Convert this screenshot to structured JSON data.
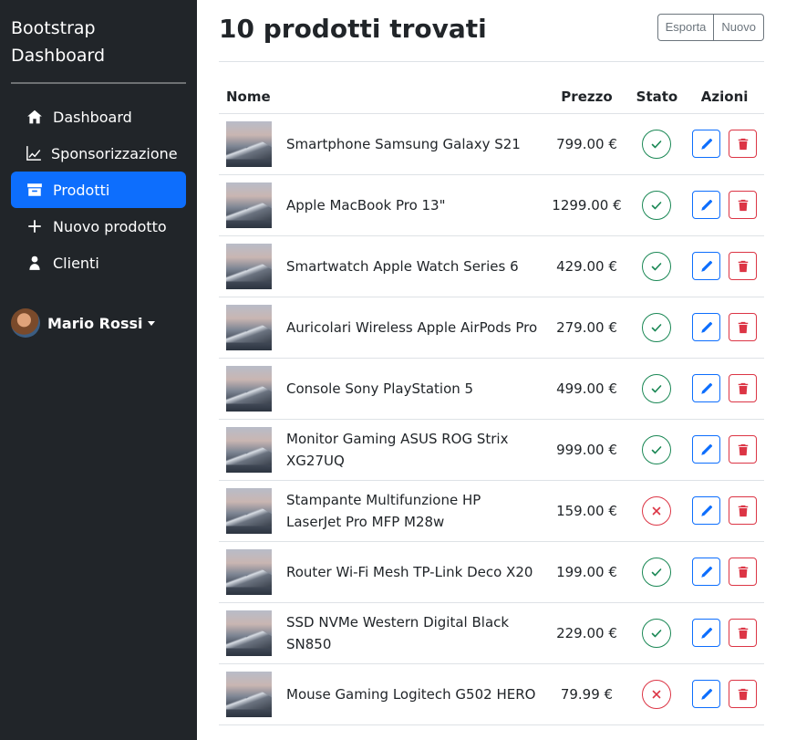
{
  "sidebar": {
    "brand_line1": "Bootstrap",
    "brand_line2": "Dashboard",
    "items": [
      {
        "label": "Dashboard",
        "icon": "home-icon"
      },
      {
        "label": "Sponsorizzazione",
        "icon": "chart-line-icon"
      },
      {
        "label": "Prodotti",
        "icon": "archive-box-icon",
        "active": true
      },
      {
        "label": "Nuovo prodotto",
        "icon": "plus-icon"
      },
      {
        "label": "Clienti",
        "icon": "user-icon"
      }
    ],
    "user_name": "Mario Rossi"
  },
  "header": {
    "title": "10 prodotti trovati",
    "export_label": "Esporta",
    "new_label": "Nuovo"
  },
  "table": {
    "columns": [
      "Nome",
      "Prezzo",
      "Stato",
      "Azioni"
    ],
    "rows": [
      {
        "name": "Smartphone Samsung Galaxy S21",
        "price": "799.00 €",
        "status": "ok"
      },
      {
        "name": "Apple MacBook Pro 13\"",
        "price": "1299.00 €",
        "status": "ok"
      },
      {
        "name": "Smartwatch Apple Watch Series 6",
        "price": "429.00 €",
        "status": "ok"
      },
      {
        "name": "Auricolari Wireless Apple AirPods Pro",
        "price": "279.00 €",
        "status": "ok"
      },
      {
        "name": "Console Sony PlayStation 5",
        "price": "499.00 €",
        "status": "ok"
      },
      {
        "name": "Monitor Gaming ASUS ROG Strix XG27UQ",
        "price": "999.00 €",
        "status": "ok"
      },
      {
        "name": "Stampante Multifunzione HP LaserJet Pro MFP M28w",
        "price": "159.00 €",
        "status": "no"
      },
      {
        "name": "Router Wi-Fi Mesh TP-Link Deco X20",
        "price": "199.00 €",
        "status": "ok"
      },
      {
        "name": "SSD NVMe Western Digital Black SN850",
        "price": "229.00 €",
        "status": "ok"
      },
      {
        "name": "Mouse Gaming Logitech G502 HERO",
        "price": "79.99 €",
        "status": "no"
      }
    ]
  },
  "colors": {
    "sidebar_bg": "#212529",
    "primary": "#0d6efd",
    "success": "#198754",
    "danger": "#dc3545"
  }
}
